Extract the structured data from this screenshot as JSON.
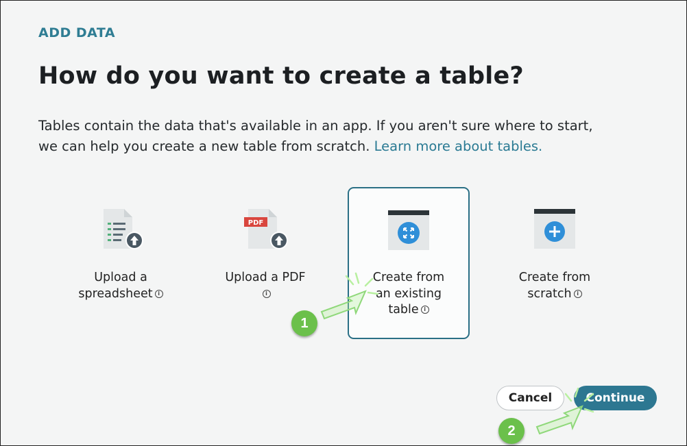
{
  "header": {
    "eyebrow": "ADD DATA",
    "title": "How do you want to create a table?"
  },
  "description": {
    "line1": "Tables contain the data that's available in an app. If you aren't sure where to start,",
    "line2_prefix": "we can help you create a new table from scratch. ",
    "link": "Learn more about tables."
  },
  "options": [
    {
      "line1": "Upload a",
      "line2": "spreadsheet",
      "line3": "",
      "icon": "spreadsheet-upload-icon",
      "selected": false
    },
    {
      "line1": "Upload a PDF",
      "line2": "",
      "line3": "",
      "icon": "pdf-upload-icon",
      "badge": "PDF",
      "selected": false
    },
    {
      "line1": "Create from",
      "line2": "an existing",
      "line3": "table",
      "icon": "existing-table-icon",
      "selected": true
    },
    {
      "line1": "Create from",
      "line2": "scratch",
      "line3": "",
      "icon": "new-table-icon",
      "selected": false
    }
  ],
  "buttons": {
    "cancel": "Cancel",
    "continue": "Continue"
  },
  "steps": [
    "1",
    "2"
  ],
  "colors": {
    "accent": "#2d7791",
    "eyebrow": "#2f7d93",
    "step_badge": "#6bc04b",
    "pointer": "#b8f0a0"
  }
}
